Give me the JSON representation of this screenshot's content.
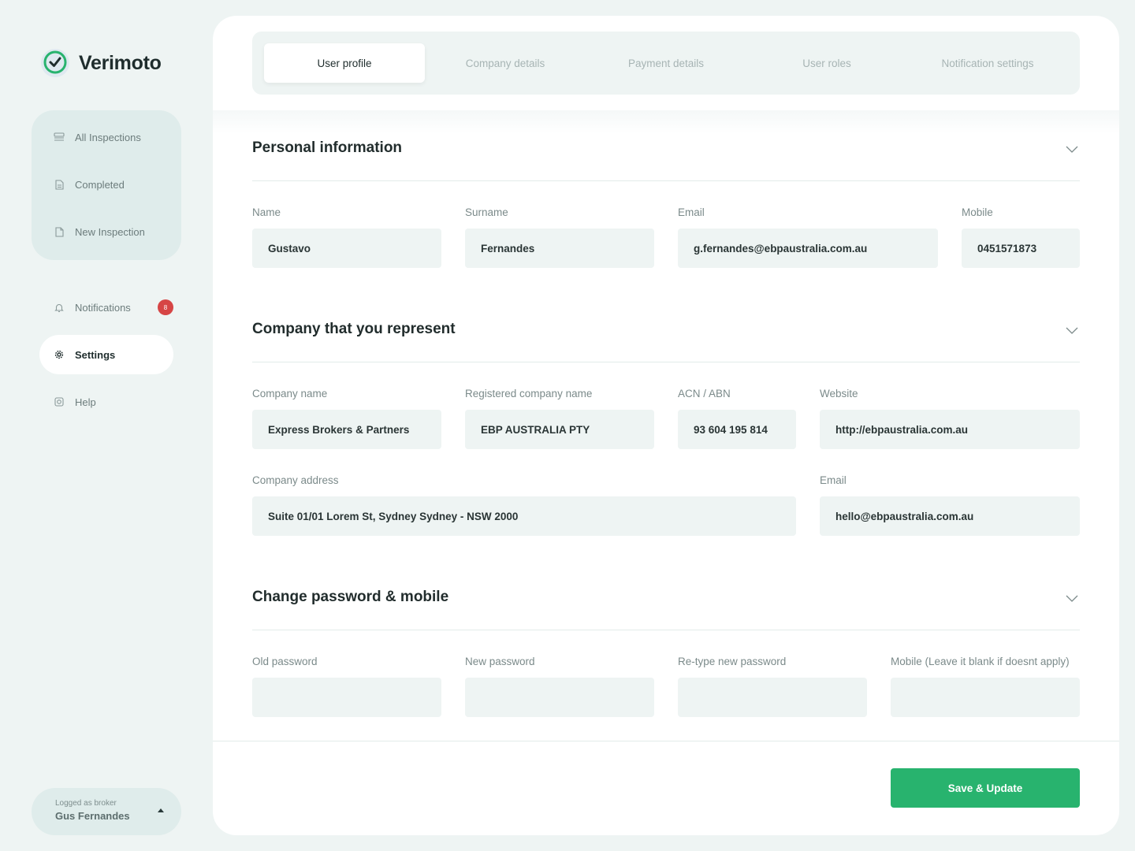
{
  "app": {
    "name": "Verimoto"
  },
  "sidebar": {
    "group_items": [
      {
        "label": "All Inspections",
        "icon": "inbox-icon"
      },
      {
        "label": "Completed",
        "icon": "document-check-icon"
      },
      {
        "label": "New Inspection",
        "icon": "document-icon"
      }
    ],
    "notifications": {
      "label": "Notifications",
      "count": "8",
      "icon": "bell-icon"
    },
    "settings": {
      "label": "Settings",
      "icon": "gear-icon"
    },
    "help": {
      "label": "Help",
      "icon": "help-icon"
    }
  },
  "user": {
    "caption": "Logged as broker",
    "name": "Gus Fernandes"
  },
  "tabs": [
    {
      "label": "User profile",
      "active": true
    },
    {
      "label": "Company details",
      "active": false
    },
    {
      "label": "Payment details",
      "active": false
    },
    {
      "label": "User roles",
      "active": false
    },
    {
      "label": "Notification settings",
      "active": false
    }
  ],
  "personal": {
    "title": "Personal information",
    "name_label": "Name",
    "name_value": "Gustavo",
    "surname_label": "Surname",
    "surname_value": "Fernandes",
    "email_label": "Email",
    "email_value": "g.fernandes@ebpaustralia.com.au",
    "mobile_label": "Mobile",
    "mobile_value": "0451571873"
  },
  "company": {
    "title": "Company that you represent",
    "company_name_label": "Company name",
    "company_name_value": "Express Brokers & Partners",
    "registered_label": "Registered company name",
    "registered_value": "EBP AUSTRALIA PTY",
    "acn_label": "ACN / ABN",
    "acn_value": "93 604 195 814",
    "website_label": "Website",
    "website_value": "http://ebpaustralia.com.au",
    "address_label": "Company address",
    "address_value": "Suite 01/01 Lorem St, Sydney Sydney - NSW 2000",
    "email_label": "Email",
    "email_value": "hello@ebpaustralia.com.au"
  },
  "password": {
    "title": "Change password & mobile",
    "old_label": "Old password",
    "new_label": "New password",
    "retype_label": "Re-type new password",
    "mobile_label": "Mobile (Leave it blank if doesnt apply)"
  },
  "actions": {
    "save_label": "Save & Update"
  },
  "colors": {
    "accent": "#28b36e",
    "badge": "#d64545",
    "background": "#eef4f3"
  }
}
